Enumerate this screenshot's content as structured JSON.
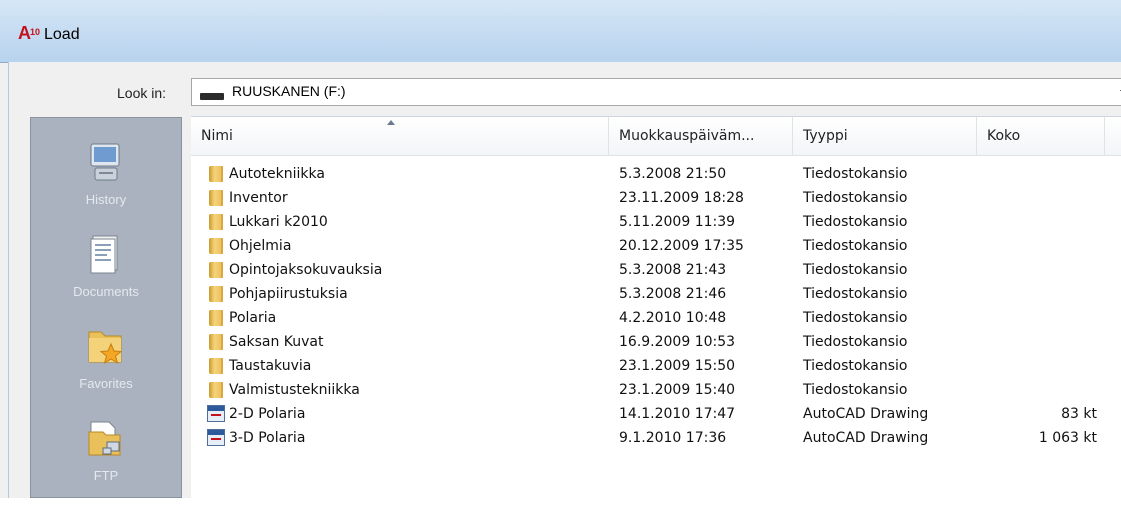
{
  "window": {
    "logo_main": "A",
    "logo_sub": "10",
    "title": "Load"
  },
  "lookin": {
    "label": "Look in:",
    "value": "RUUSKANEN (F:)"
  },
  "places": [
    {
      "label": "History",
      "icon": "history-icon"
    },
    {
      "label": "Documents",
      "icon": "documents-icon"
    },
    {
      "label": "Favorites",
      "icon": "favorites-icon"
    },
    {
      "label": "FTP",
      "icon": "ftp-icon"
    }
  ],
  "columns": {
    "name": "Nimi",
    "date": "Muokkauspäiväm...",
    "type": "Tyyppi",
    "size": "Koko"
  },
  "files": [
    {
      "name": "Autotekniikka",
      "date": "5.3.2008 21:50",
      "type": "Tiedostokansio",
      "size": "",
      "icon": "folder-icon"
    },
    {
      "name": "Inventor",
      "date": "23.11.2009 18:28",
      "type": "Tiedostokansio",
      "size": "",
      "icon": "folder-icon"
    },
    {
      "name": "Lukkari k2010",
      "date": "5.11.2009 11:39",
      "type": "Tiedostokansio",
      "size": "",
      "icon": "folder-icon"
    },
    {
      "name": "Ohjelmia",
      "date": "20.12.2009 17:35",
      "type": "Tiedostokansio",
      "size": "",
      "icon": "folder-icon"
    },
    {
      "name": "Opintojaksokuvauksia",
      "date": "5.3.2008 21:43",
      "type": "Tiedostokansio",
      "size": "",
      "icon": "folder-icon"
    },
    {
      "name": "Pohjapiirustuksia",
      "date": "5.3.2008 21:46",
      "type": "Tiedostokansio",
      "size": "",
      "icon": "folder-icon"
    },
    {
      "name": "Polaria",
      "date": "4.2.2010 10:48",
      "type": "Tiedostokansio",
      "size": "",
      "icon": "folder-icon"
    },
    {
      "name": "Saksan Kuvat",
      "date": "16.9.2009 10:53",
      "type": "Tiedostokansio",
      "size": "",
      "icon": "folder-icon"
    },
    {
      "name": "Taustakuvia",
      "date": "23.1.2009 15:50",
      "type": "Tiedostokansio",
      "size": "",
      "icon": "folder-icon"
    },
    {
      "name": "Valmistustekniikka",
      "date": "23.1.2009 15:40",
      "type": "Tiedostokansio",
      "size": "",
      "icon": "folder-icon"
    },
    {
      "name": "2-D Polaria",
      "date": "14.1.2010 17:47",
      "type": "AutoCAD Drawing",
      "size": "83 kt",
      "icon": "dwg-file-icon"
    },
    {
      "name": "3-D Polaria",
      "date": "9.1.2010 17:36",
      "type": "AutoCAD Drawing",
      "size": "1 063 kt",
      "icon": "dwg-file-icon"
    }
  ]
}
